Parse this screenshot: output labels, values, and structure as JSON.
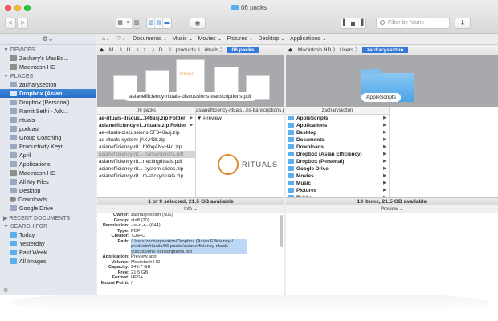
{
  "window": {
    "title": "06 packs",
    "back": "<",
    "forward": ">",
    "search_placeholder": "Filter by Name",
    "action_label": "⬇"
  },
  "menubar": {
    "items": [
      "Documents ⌄",
      "Music ⌄",
      "Movies ⌄",
      "Pictures ⌄",
      "Desktop ⌄",
      "Applications ⌄"
    ]
  },
  "sidebar": {
    "gear_label": "⚙⌄",
    "sections": [
      {
        "title": "▼ DEVICES",
        "items": [
          {
            "label": "Zachary's MacBo...",
            "icon": "laptop-icon",
            "cls": "ic-drive"
          },
          {
            "label": "Macintosh HD",
            "icon": "drive-icon",
            "cls": "ic-drive"
          }
        ]
      },
      {
        "title": "▼ PLACES",
        "items": [
          {
            "label": "zacharysexton",
            "icon": "home-icon",
            "cls": "ic-folder"
          },
          {
            "label": "Dropbox (Asian...",
            "icon": "folder-icon",
            "cls": "ic-folder",
            "selected": true
          },
          {
            "label": "Dropbox (Personal)",
            "icon": "folder-icon",
            "cls": "ic-folder"
          },
          {
            "label": "Ramit Sethi - Adv...",
            "icon": "folder-icon",
            "cls": "ic-folder"
          },
          {
            "label": "rituals",
            "icon": "folder-icon",
            "cls": "ic-folder"
          },
          {
            "label": "podcast",
            "icon": "folder-icon",
            "cls": "ic-folder"
          },
          {
            "label": "Group Coaching",
            "icon": "folder-icon",
            "cls": "ic-folder"
          },
          {
            "label": "Productivity Keyn...",
            "icon": "folder-icon",
            "cls": "ic-folder"
          },
          {
            "label": "April",
            "icon": "folder-icon",
            "cls": "ic-folder"
          },
          {
            "label": "Applications",
            "icon": "applications-icon",
            "cls": "ic-app"
          },
          {
            "label": "Macintosh HD",
            "icon": "drive-icon",
            "cls": "ic-drive"
          },
          {
            "label": "All My Files",
            "icon": "all-files-icon",
            "cls": "ic-folder"
          },
          {
            "label": "Desktop",
            "icon": "folder-icon",
            "cls": "ic-folder"
          },
          {
            "label": "Downloads",
            "icon": "downloads-icon",
            "cls": "ic-down"
          },
          {
            "label": "Google Drive",
            "icon": "folder-icon",
            "cls": "ic-folder"
          }
        ]
      },
      {
        "title": "▶ RECENT DOCUMENTS",
        "items": []
      },
      {
        "title": "▼ SEARCH FOR",
        "items": [
          {
            "label": "Today",
            "icon": "calendar-icon",
            "cls": "ic-day"
          },
          {
            "label": "Yesterday",
            "icon": "calendar-icon",
            "cls": "ic-day"
          },
          {
            "label": "Past Week",
            "icon": "calendar-icon",
            "cls": "ic-day"
          },
          {
            "label": "All Images",
            "icon": "images-icon",
            "cls": "ic-day"
          }
        ]
      }
    ]
  },
  "left_pane": {
    "path": [
      "M...",
      "U...",
      "z...",
      "D...",
      "products",
      "rituals"
    ],
    "active_crumb": "06 packs",
    "preview_caption": "asianefficiency-rituals-discussions-transcriptions.pdf",
    "thumb_logo": "RITUALS",
    "col1_header": "06 packs",
    "col2_header": "asianefficiency-rituals...ns-transcriptions.pdf",
    "files": [
      {
        "name": "ae-rituals-discus...346asj.zip Folder",
        "style": "bold",
        "arrow": "▶"
      },
      {
        "name": "asianefficiency-ri...rituals.zip Folder",
        "style": "bold",
        "arrow": "▶"
      },
      {
        "name": "ae-rituals-discussions-SF346asj.zip",
        "style": "",
        "arrow": ""
      },
      {
        "name": "ae-rituals-system-jAKJ43f.zip",
        "style": "",
        "arrow": ""
      },
      {
        "name": "asianefficiency-rit...bXbqANvH4o.zip",
        "style": "",
        "arrow": ""
      },
      {
        "name": "asianefficiency-rit...-transcriptions.pdf",
        "style": "sel",
        "arrow": ""
      },
      {
        "name": "asianefficiency-rit...rrectingrituals.pdf",
        "style": "",
        "arrow": ""
      },
      {
        "name": "asianefficiency-rit...-system-slides.zip",
        "style": "",
        "arrow": ""
      },
      {
        "name": "asianefficiency-rit...m-stickyrituals.zip",
        "style": "",
        "arrow": ""
      }
    ],
    "preview_label": "▼ Preview",
    "preview_logo": "RITUALS",
    "status": "1 of 9 selected, 21.5 GB available"
  },
  "right_pane": {
    "path": [
      "Macintosh HD",
      "Users"
    ],
    "active_crumb": "zacharysexton",
    "preview_caption": "AppleScripts",
    "col_header": "zacharysexton",
    "folders": [
      "AppleScripts",
      "Applications",
      "Desktop",
      "Documents",
      "Downloads",
      "Dropbox (Asian Efficiency)",
      "Dropbox (Personal)",
      "Google Drive",
      "Movies",
      "Music",
      "Pictures",
      "Public"
    ],
    "status": "13 items, 21.5 GB available",
    "bottom_header": "Preview ⌄"
  },
  "info": {
    "header": "Info ⌄",
    "rows": [
      {
        "k": "Owner:",
        "v": "zacharysexton (501)"
      },
      {
        "k": "Group:",
        "v": "staff (20)"
      },
      {
        "k": "Permission:",
        "v": "-rw-r--r-- (644)"
      },
      {
        "k": "Type:",
        "v": "PDF"
      },
      {
        "k": "Creator:",
        "v": "'CARO'"
      },
      {
        "k": "Path:",
        "v": "/Users/zacharysexton/Dropbox (Asian Efficiency)/ products/rituals/06 packs/asianefficiency-rituals- discussions-transcriptions.pdf",
        "hl": true
      },
      {
        "k": "Application:",
        "v": "Preview.app"
      },
      {
        "k": "Volume:",
        "v": "Macintosh HD"
      },
      {
        "k": "Capacity:",
        "v": "249.7 GB"
      },
      {
        "k": "Free:",
        "v": "21.5 GB"
      },
      {
        "k": "Format:",
        "v": "HFS+"
      },
      {
        "k": "Mount Point:",
        "v": "/"
      }
    ]
  }
}
